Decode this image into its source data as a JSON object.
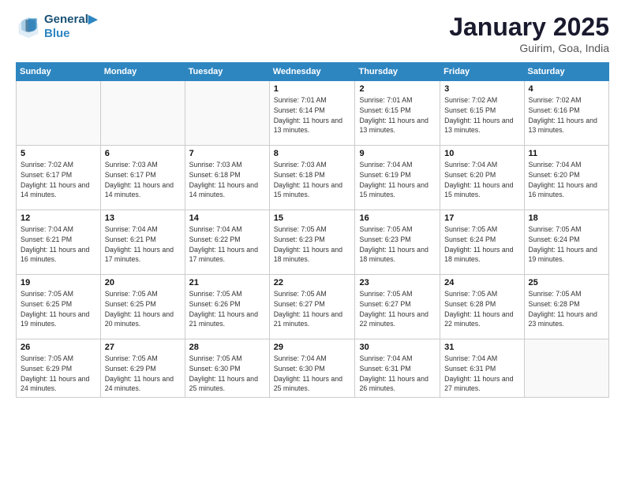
{
  "header": {
    "logo_line1": "General",
    "logo_line2": "Blue",
    "month": "January 2025",
    "location": "Guirim, Goa, India"
  },
  "weekdays": [
    "Sunday",
    "Monday",
    "Tuesday",
    "Wednesday",
    "Thursday",
    "Friday",
    "Saturday"
  ],
  "weeks": [
    [
      {
        "day": "",
        "info": ""
      },
      {
        "day": "",
        "info": ""
      },
      {
        "day": "",
        "info": ""
      },
      {
        "day": "1",
        "info": "Sunrise: 7:01 AM\nSunset: 6:14 PM\nDaylight: 11 hours\nand 13 minutes."
      },
      {
        "day": "2",
        "info": "Sunrise: 7:01 AM\nSunset: 6:15 PM\nDaylight: 11 hours\nand 13 minutes."
      },
      {
        "day": "3",
        "info": "Sunrise: 7:02 AM\nSunset: 6:15 PM\nDaylight: 11 hours\nand 13 minutes."
      },
      {
        "day": "4",
        "info": "Sunrise: 7:02 AM\nSunset: 6:16 PM\nDaylight: 11 hours\nand 13 minutes."
      }
    ],
    [
      {
        "day": "5",
        "info": "Sunrise: 7:02 AM\nSunset: 6:17 PM\nDaylight: 11 hours\nand 14 minutes."
      },
      {
        "day": "6",
        "info": "Sunrise: 7:03 AM\nSunset: 6:17 PM\nDaylight: 11 hours\nand 14 minutes."
      },
      {
        "day": "7",
        "info": "Sunrise: 7:03 AM\nSunset: 6:18 PM\nDaylight: 11 hours\nand 14 minutes."
      },
      {
        "day": "8",
        "info": "Sunrise: 7:03 AM\nSunset: 6:18 PM\nDaylight: 11 hours\nand 15 minutes."
      },
      {
        "day": "9",
        "info": "Sunrise: 7:04 AM\nSunset: 6:19 PM\nDaylight: 11 hours\nand 15 minutes."
      },
      {
        "day": "10",
        "info": "Sunrise: 7:04 AM\nSunset: 6:20 PM\nDaylight: 11 hours\nand 15 minutes."
      },
      {
        "day": "11",
        "info": "Sunrise: 7:04 AM\nSunset: 6:20 PM\nDaylight: 11 hours\nand 16 minutes."
      }
    ],
    [
      {
        "day": "12",
        "info": "Sunrise: 7:04 AM\nSunset: 6:21 PM\nDaylight: 11 hours\nand 16 minutes."
      },
      {
        "day": "13",
        "info": "Sunrise: 7:04 AM\nSunset: 6:21 PM\nDaylight: 11 hours\nand 17 minutes."
      },
      {
        "day": "14",
        "info": "Sunrise: 7:04 AM\nSunset: 6:22 PM\nDaylight: 11 hours\nand 17 minutes."
      },
      {
        "day": "15",
        "info": "Sunrise: 7:05 AM\nSunset: 6:23 PM\nDaylight: 11 hours\nand 18 minutes."
      },
      {
        "day": "16",
        "info": "Sunrise: 7:05 AM\nSunset: 6:23 PM\nDaylight: 11 hours\nand 18 minutes."
      },
      {
        "day": "17",
        "info": "Sunrise: 7:05 AM\nSunset: 6:24 PM\nDaylight: 11 hours\nand 18 minutes."
      },
      {
        "day": "18",
        "info": "Sunrise: 7:05 AM\nSunset: 6:24 PM\nDaylight: 11 hours\nand 19 minutes."
      }
    ],
    [
      {
        "day": "19",
        "info": "Sunrise: 7:05 AM\nSunset: 6:25 PM\nDaylight: 11 hours\nand 19 minutes."
      },
      {
        "day": "20",
        "info": "Sunrise: 7:05 AM\nSunset: 6:25 PM\nDaylight: 11 hours\nand 20 minutes."
      },
      {
        "day": "21",
        "info": "Sunrise: 7:05 AM\nSunset: 6:26 PM\nDaylight: 11 hours\nand 21 minutes."
      },
      {
        "day": "22",
        "info": "Sunrise: 7:05 AM\nSunset: 6:27 PM\nDaylight: 11 hours\nand 21 minutes."
      },
      {
        "day": "23",
        "info": "Sunrise: 7:05 AM\nSunset: 6:27 PM\nDaylight: 11 hours\nand 22 minutes."
      },
      {
        "day": "24",
        "info": "Sunrise: 7:05 AM\nSunset: 6:28 PM\nDaylight: 11 hours\nand 22 minutes."
      },
      {
        "day": "25",
        "info": "Sunrise: 7:05 AM\nSunset: 6:28 PM\nDaylight: 11 hours\nand 23 minutes."
      }
    ],
    [
      {
        "day": "26",
        "info": "Sunrise: 7:05 AM\nSunset: 6:29 PM\nDaylight: 11 hours\nand 24 minutes."
      },
      {
        "day": "27",
        "info": "Sunrise: 7:05 AM\nSunset: 6:29 PM\nDaylight: 11 hours\nand 24 minutes."
      },
      {
        "day": "28",
        "info": "Sunrise: 7:05 AM\nSunset: 6:30 PM\nDaylight: 11 hours\nand 25 minutes."
      },
      {
        "day": "29",
        "info": "Sunrise: 7:04 AM\nSunset: 6:30 PM\nDaylight: 11 hours\nand 25 minutes."
      },
      {
        "day": "30",
        "info": "Sunrise: 7:04 AM\nSunset: 6:31 PM\nDaylight: 11 hours\nand 26 minutes."
      },
      {
        "day": "31",
        "info": "Sunrise: 7:04 AM\nSunset: 6:31 PM\nDaylight: 11 hours\nand 27 minutes."
      },
      {
        "day": "",
        "info": ""
      }
    ]
  ]
}
